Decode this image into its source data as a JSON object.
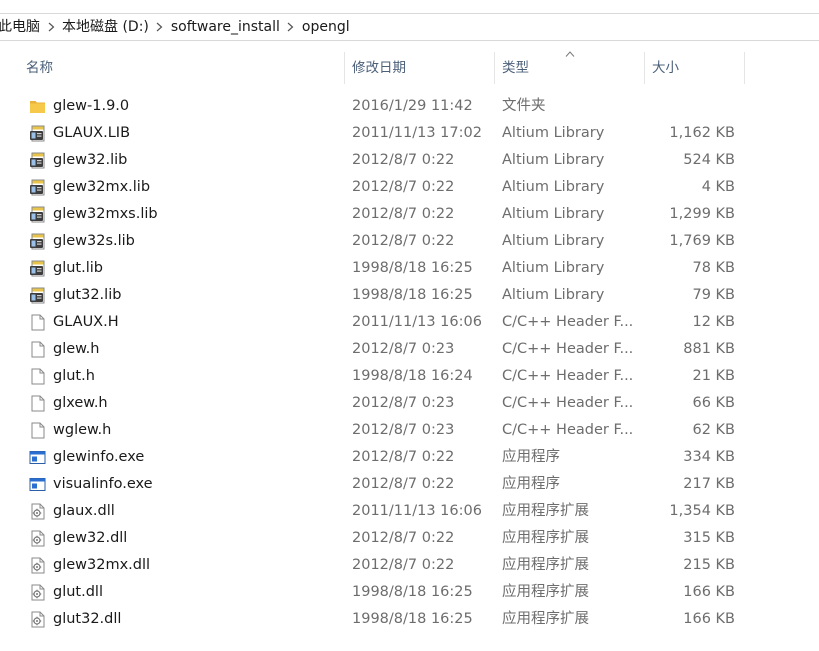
{
  "breadcrumb": [
    {
      "label": "此电脑"
    },
    {
      "label": "本地磁盘 (D:)"
    },
    {
      "label": "software_install"
    },
    {
      "label": "opengl"
    }
  ],
  "columns": {
    "name": "名称",
    "date": "修改日期",
    "type": "类型",
    "size": "大小"
  },
  "sort": {
    "column": "type",
    "direction": "ascending"
  },
  "files": [
    {
      "name": "glew-1.9.0",
      "date": "2016/1/29 11:42",
      "type": "文件夹",
      "size": "",
      "icon": "folder-icon"
    },
    {
      "name": "GLAUX.LIB",
      "date": "2011/11/13 17:02",
      "type": "Altium Library",
      "size": "1,162 KB",
      "icon": "library-icon"
    },
    {
      "name": "glew32.lib",
      "date": "2012/8/7 0:22",
      "type": "Altium Library",
      "size": "524 KB",
      "icon": "library-icon"
    },
    {
      "name": "glew32mx.lib",
      "date": "2012/8/7 0:22",
      "type": "Altium Library",
      "size": "4 KB",
      "icon": "library-icon"
    },
    {
      "name": "glew32mxs.lib",
      "date": "2012/8/7 0:22",
      "type": "Altium Library",
      "size": "1,299 KB",
      "icon": "library-icon"
    },
    {
      "name": "glew32s.lib",
      "date": "2012/8/7 0:22",
      "type": "Altium Library",
      "size": "1,769 KB",
      "icon": "library-icon"
    },
    {
      "name": "glut.lib",
      "date": "1998/8/18 16:25",
      "type": "Altium Library",
      "size": "78 KB",
      "icon": "library-icon"
    },
    {
      "name": "glut32.lib",
      "date": "1998/8/18 16:25",
      "type": "Altium Library",
      "size": "79 KB",
      "icon": "library-icon"
    },
    {
      "name": "GLAUX.H",
      "date": "2011/11/13 16:06",
      "type": "C/C++ Header F...",
      "size": "12 KB",
      "icon": "header-file-icon"
    },
    {
      "name": "glew.h",
      "date": "2012/8/7 0:23",
      "type": "C/C++ Header F...",
      "size": "881 KB",
      "icon": "header-file-icon"
    },
    {
      "name": "glut.h",
      "date": "1998/8/18 16:24",
      "type": "C/C++ Header F...",
      "size": "21 KB",
      "icon": "header-file-icon"
    },
    {
      "name": "glxew.h",
      "date": "2012/8/7 0:23",
      "type": "C/C++ Header F...",
      "size": "66 KB",
      "icon": "header-file-icon"
    },
    {
      "name": "wglew.h",
      "date": "2012/8/7 0:23",
      "type": "C/C++ Header F...",
      "size": "62 KB",
      "icon": "header-file-icon"
    },
    {
      "name": "glewinfo.exe",
      "date": "2012/8/7 0:22",
      "type": "应用程序",
      "size": "334 KB",
      "icon": "application-icon"
    },
    {
      "name": "visualinfo.exe",
      "date": "2012/8/7 0:22",
      "type": "应用程序",
      "size": "217 KB",
      "icon": "application-icon"
    },
    {
      "name": "glaux.dll",
      "date": "2011/11/13 16:06",
      "type": "应用程序扩展",
      "size": "1,354 KB",
      "icon": "dll-icon"
    },
    {
      "name": "glew32.dll",
      "date": "2012/8/7 0:22",
      "type": "应用程序扩展",
      "size": "315 KB",
      "icon": "dll-icon"
    },
    {
      "name": "glew32mx.dll",
      "date": "2012/8/7 0:22",
      "type": "应用程序扩展",
      "size": "215 KB",
      "icon": "dll-icon"
    },
    {
      "name": "glut.dll",
      "date": "1998/8/18 16:25",
      "type": "应用程序扩展",
      "size": "166 KB",
      "icon": "dll-icon"
    },
    {
      "name": "glut32.dll",
      "date": "1998/8/18 16:25",
      "type": "应用程序扩展",
      "size": "166 KB",
      "icon": "dll-icon"
    }
  ],
  "colors": {
    "header_text": "#4c607a",
    "name_text": "#1a1a1a",
    "meta_text": "#6d6d6d",
    "folder": "#f7c94b",
    "divider": "#e5e5e5"
  }
}
